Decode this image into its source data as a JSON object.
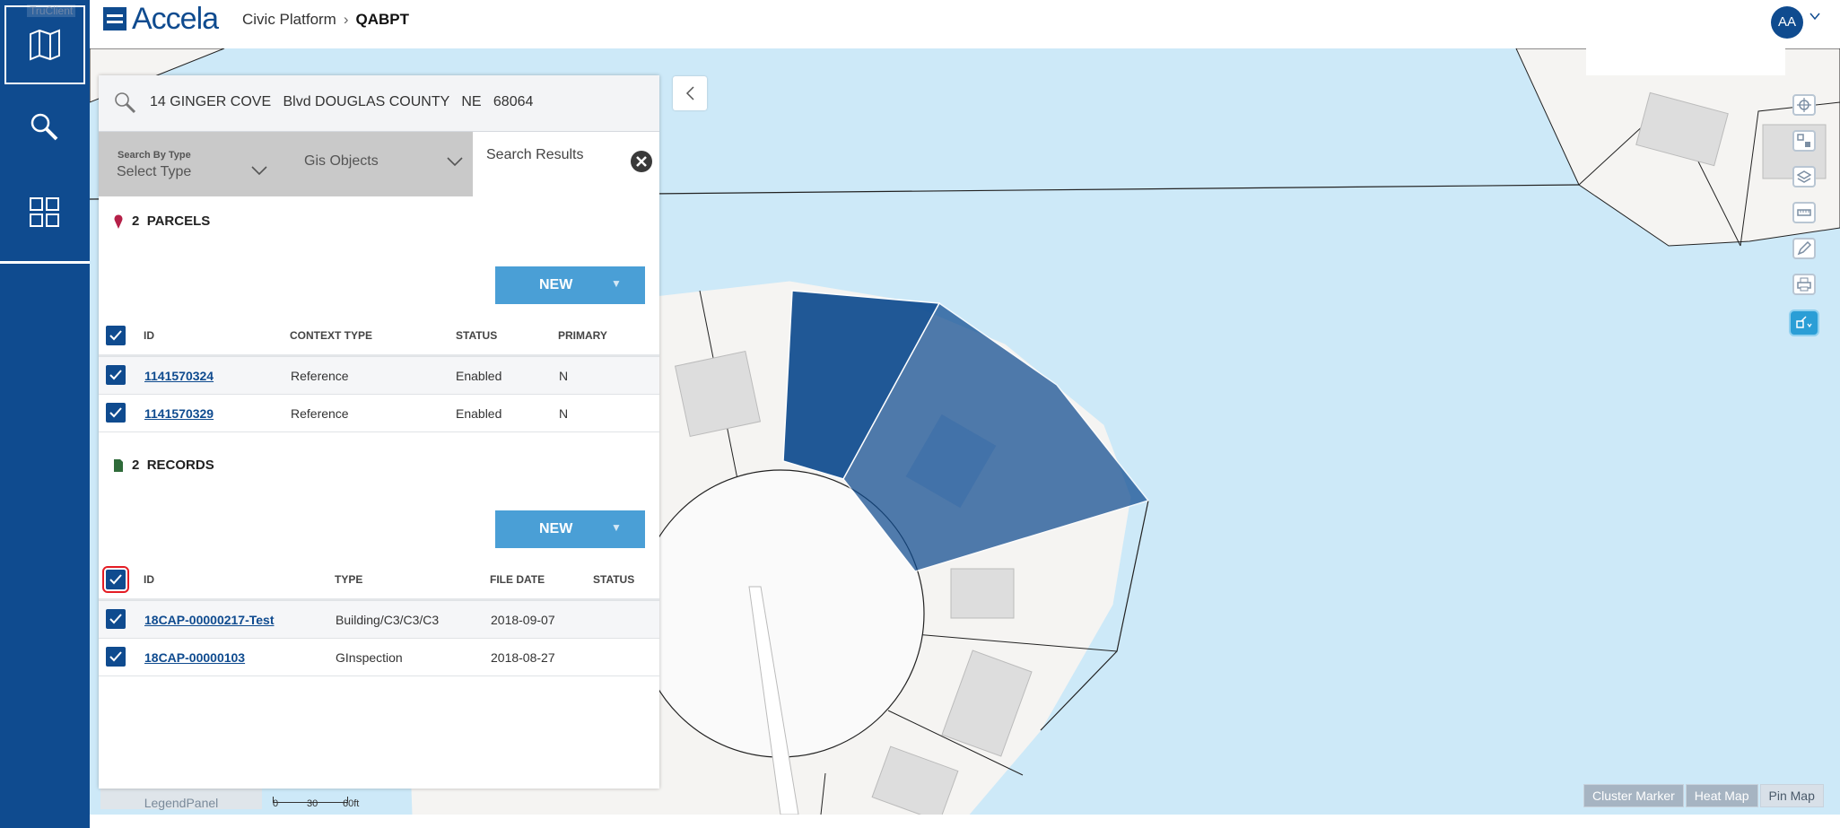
{
  "app": {
    "brand": "Accela",
    "brand_color": "#0f4b8f"
  },
  "breadcrumb": {
    "root": "Civic Platform",
    "current": "QABPT"
  },
  "user": {
    "initials": "AA"
  },
  "overlay_label": "TruClient",
  "search": {
    "query": "14 GINGER COVE   Blvd DOUGLAS COUNTY   NE   68064"
  },
  "filters": {
    "type_label": "Search By Type",
    "type_value": "Select Type",
    "gis_value": "Gis Objects",
    "results_label": "Search Results"
  },
  "parcels": {
    "count": "2",
    "title": "PARCELS",
    "new_label": "NEW",
    "columns": [
      "ID",
      "CONTEXT TYPE",
      "STATUS",
      "PRIMARY"
    ],
    "rows": [
      {
        "id": "1141570324",
        "context": "Reference",
        "status": "Enabled",
        "primary": "N"
      },
      {
        "id": "1141570329",
        "context": "Reference",
        "status": "Enabled",
        "primary": "N"
      }
    ]
  },
  "records": {
    "count": "2",
    "title": "RECORDS",
    "new_label": "NEW",
    "columns": [
      "ID",
      "TYPE",
      "FILE DATE",
      "STATUS"
    ],
    "rows": [
      {
        "id": "18CAP-00000217-Test",
        "type": "Building/C3/C3/C3",
        "date": "2018-09-07",
        "status": ""
      },
      {
        "id": "18CAP-00000103",
        "type": "GInspection",
        "date": "2018-08-27",
        "status": ""
      }
    ]
  },
  "map": {
    "legend_label": "LegendPanel",
    "scale": {
      "t0": "0",
      "t1": "30",
      "t2": "60ft"
    },
    "types": [
      "Cluster Marker",
      "Heat Map",
      "Pin Map"
    ]
  },
  "colors": {
    "water": "#cde9f8",
    "land": "#f5f4f2",
    "selection": "#0f4b8f",
    "accent": "#4a9fd6"
  }
}
